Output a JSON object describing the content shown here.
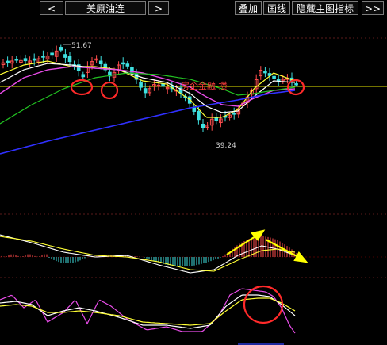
{
  "toolbar": {
    "prev_label": "<",
    "symbol": "美原油连",
    "next_label": ">",
    "overlay_label": "叠加",
    "draw_label": "画线",
    "hide_indicator_label": "隐藏主图指标",
    "expand_label": ">>"
  },
  "main_chart": {
    "high_label": "51.67",
    "low_label": "39.24",
    "annotation": "房企金融 攒"
  },
  "colors": {
    "background": "#000000",
    "up_candle": "#ff4d4d",
    "down_candle": "#3fe0e0",
    "ma_yellow": "#ffff33",
    "ma_white": "#ffffff",
    "ma_magenta": "#e84ce8",
    "ma_green": "#22c322",
    "ma_blue": "#3030ff",
    "horizontal_line": "#e6e600",
    "circle": "#ff2a2a",
    "arrow": "#ffff00"
  }
}
